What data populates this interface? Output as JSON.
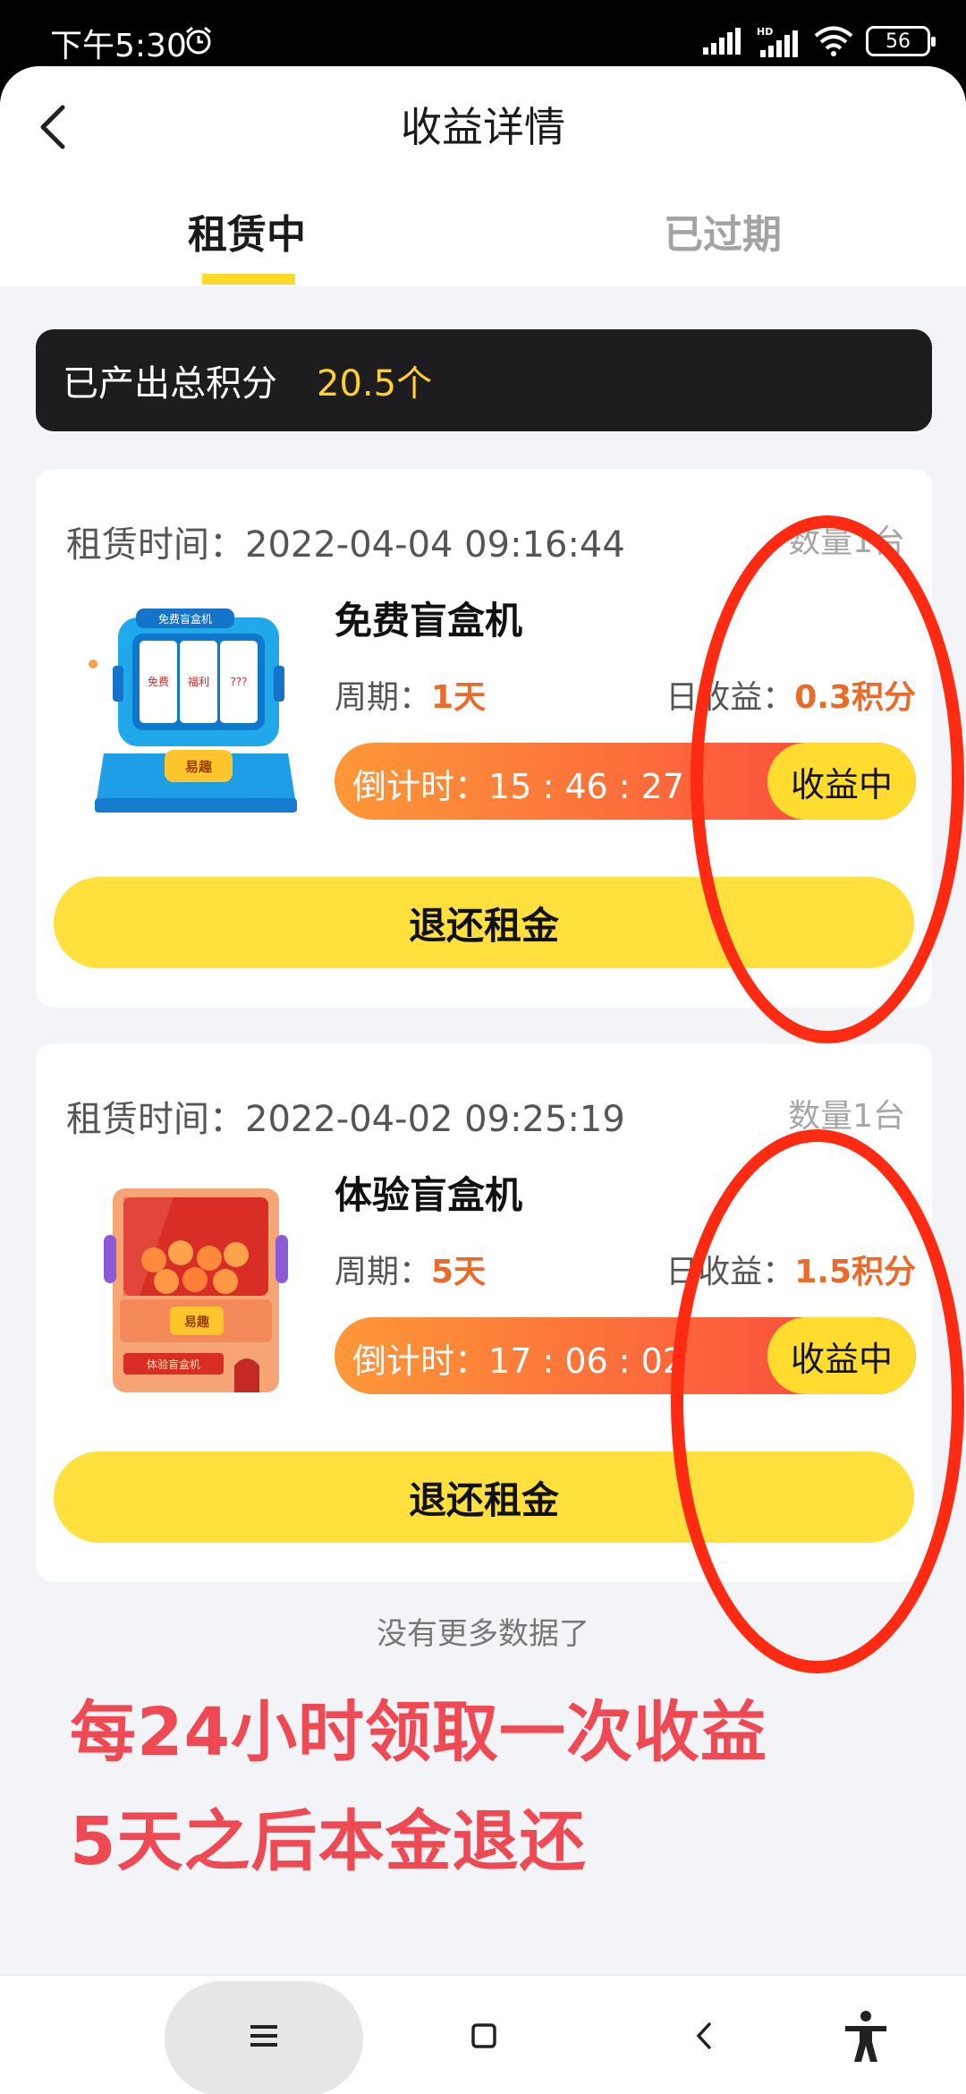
{
  "status_bar": {
    "time": "下午5:30",
    "battery": "56",
    "icons": [
      "alarm-icon",
      "signal-icon",
      "hd-signal-icon",
      "wifi-icon",
      "battery-icon"
    ]
  },
  "header": {
    "title": "收益详情",
    "back_icon": "chevron-left-icon"
  },
  "tabs": [
    {
      "label": "租赁中",
      "active": true
    },
    {
      "label": "已过期",
      "active": false
    }
  ],
  "summary": {
    "label": "已产出总积分",
    "value": "20.5个"
  },
  "cards": [
    {
      "time_label": "租赁时间：",
      "time": "2022-04-04 09:16:44",
      "quantity": "数量1台",
      "name": "免费盲盒机",
      "period_label": "周期：",
      "period": "1天",
      "daily_label": "日收益：",
      "daily": "0.3积分",
      "countdown_label": "倒计时：",
      "countdown": "15 : 46 : 27",
      "status": "收益中",
      "button": "退还租金"
    },
    {
      "time_label": "租赁时间：",
      "time": "2022-04-02 09:25:19",
      "quantity": "数量1台",
      "name": "体验盲盒机",
      "period_label": "周期：",
      "period": "5天",
      "daily_label": "日收益：",
      "daily": "1.5积分",
      "countdown_label": "倒计时：",
      "countdown": "17 : 06 : 02",
      "status": "收益中",
      "button": "退还租金"
    }
  ],
  "machine1_text": {
    "sign": "免费盲盒机",
    "reel1": "免费",
    "reel2": "福利",
    "reel3": "???",
    "button": "易趣"
  },
  "machine2_text": {
    "sign": "体验盲盒机",
    "button": "易趣"
  },
  "footer": {
    "no_more": "没有更多数据了"
  },
  "annotation": {
    "line1": "每24小时领取一次收益",
    "line2": "5天之后本金退还",
    "color": "#ef4a53"
  },
  "circle_color": "#ff2a12",
  "accent": "#ffd927",
  "nav_bar": {
    "icons": [
      "menu-icon",
      "home-icon",
      "back-icon",
      "accessibility-icon"
    ]
  }
}
